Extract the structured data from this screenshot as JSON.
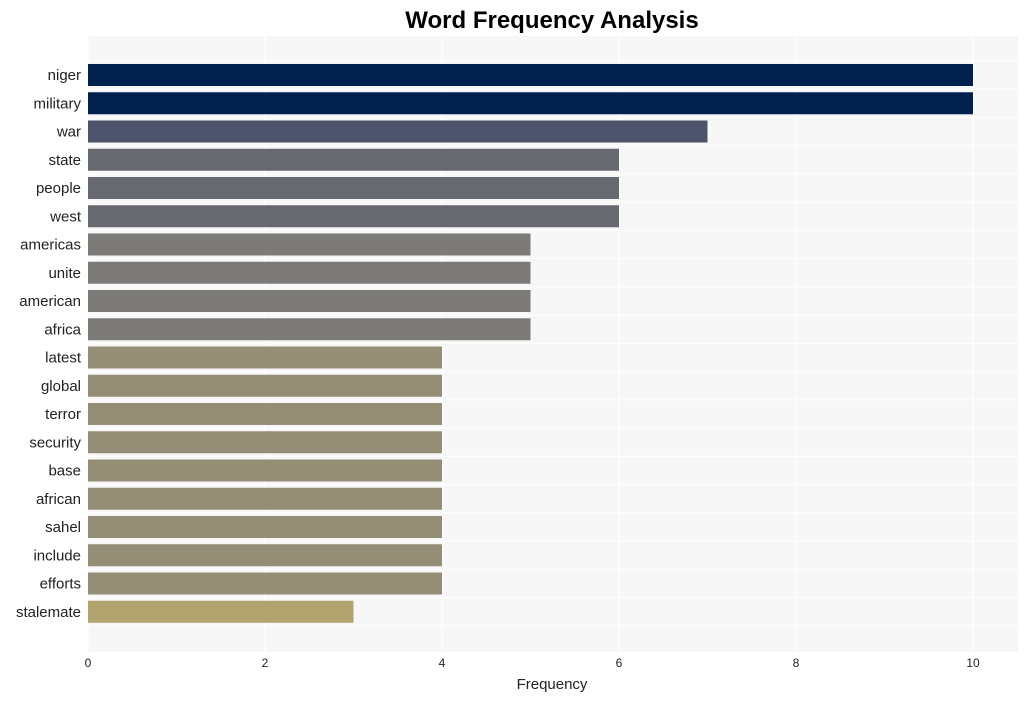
{
  "chart_data": {
    "type": "bar",
    "orientation": "horizontal",
    "title": "Word Frequency Analysis",
    "xlabel": "Frequency",
    "ylabel": "",
    "xlim": [
      0,
      10.5
    ],
    "xticks": [
      0,
      2,
      4,
      6,
      8,
      10
    ],
    "grid": true,
    "categories": [
      "niger",
      "military",
      "war",
      "state",
      "people",
      "west",
      "americas",
      "unite",
      "american",
      "africa",
      "latest",
      "global",
      "terror",
      "security",
      "base",
      "african",
      "sahel",
      "include",
      "efforts",
      "stalemate"
    ],
    "values": [
      10,
      10,
      7,
      6,
      6,
      6,
      5,
      5,
      5,
      5,
      4,
      4,
      4,
      4,
      4,
      4,
      4,
      4,
      4,
      3
    ],
    "colors": [
      "#00204e",
      "#00204e",
      "#4d546b",
      "#676970",
      "#676970",
      "#676970",
      "#7c7b78",
      "#7c7b78",
      "#7c7b78",
      "#7c7b78",
      "#958e76",
      "#958e76",
      "#958e76",
      "#958e76",
      "#958e76",
      "#958e76",
      "#958e76",
      "#958e76",
      "#958e76",
      "#b1a46f"
    ]
  }
}
